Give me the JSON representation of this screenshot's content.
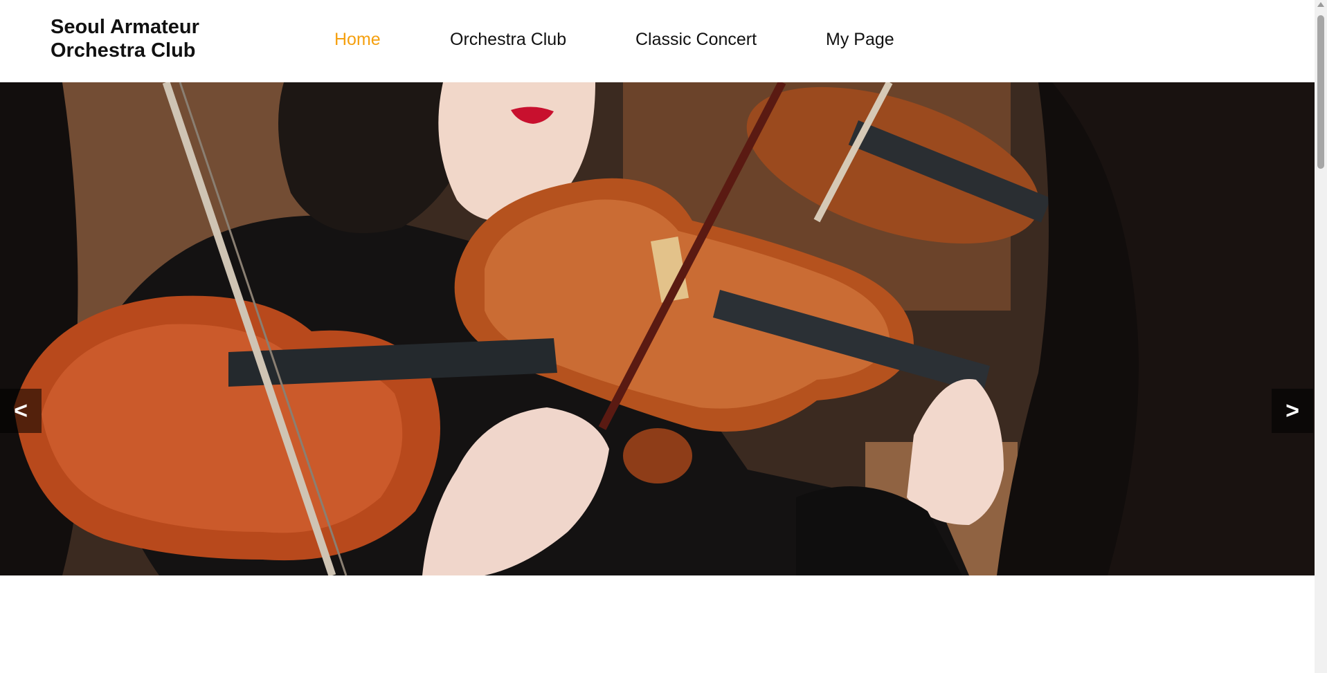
{
  "site": {
    "logo_line1": "Seoul Armateur",
    "logo_line2": "Orchestra Club"
  },
  "nav": {
    "items": [
      {
        "label": "Home",
        "active": true
      },
      {
        "label": "Orchestra Club",
        "active": false
      },
      {
        "label": "Classic Concert",
        "active": false
      },
      {
        "label": "My Page",
        "active": false
      }
    ],
    "active_color": "#f5a00f"
  },
  "carousel": {
    "prev_label": "<",
    "next_label": ">"
  }
}
